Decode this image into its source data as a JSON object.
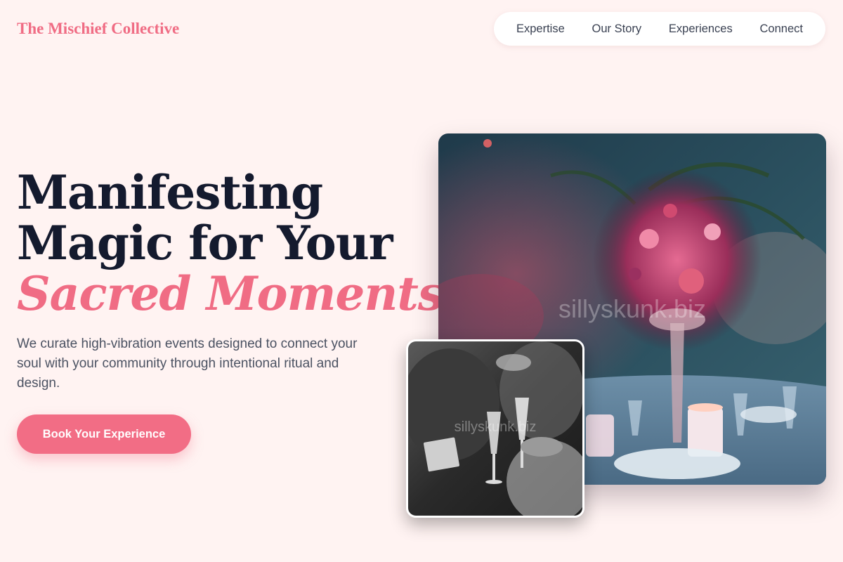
{
  "brand": {
    "name": "The Mischief Collective"
  },
  "nav": {
    "items": [
      {
        "label": "Expertise"
      },
      {
        "label": "Our Story"
      },
      {
        "label": "Experiences"
      },
      {
        "label": "Connect"
      }
    ]
  },
  "hero": {
    "headline_line1": "Manifesting",
    "headline_line2": "Magic for Your",
    "headline_accent": "Sacred Moments.",
    "lede": "We curate high-vibration events designed to connect your soul with your community through intentional ritual and design.",
    "cta_label": "Book Your Experience"
  },
  "images": {
    "main_watermark": "sillyskunk.biz",
    "small_watermark": "sillyskunk.biz"
  },
  "colors": {
    "background": "#fff3f2",
    "accent": "#f06c84",
    "headline": "#141a2e",
    "body_text": "#4b5262"
  }
}
